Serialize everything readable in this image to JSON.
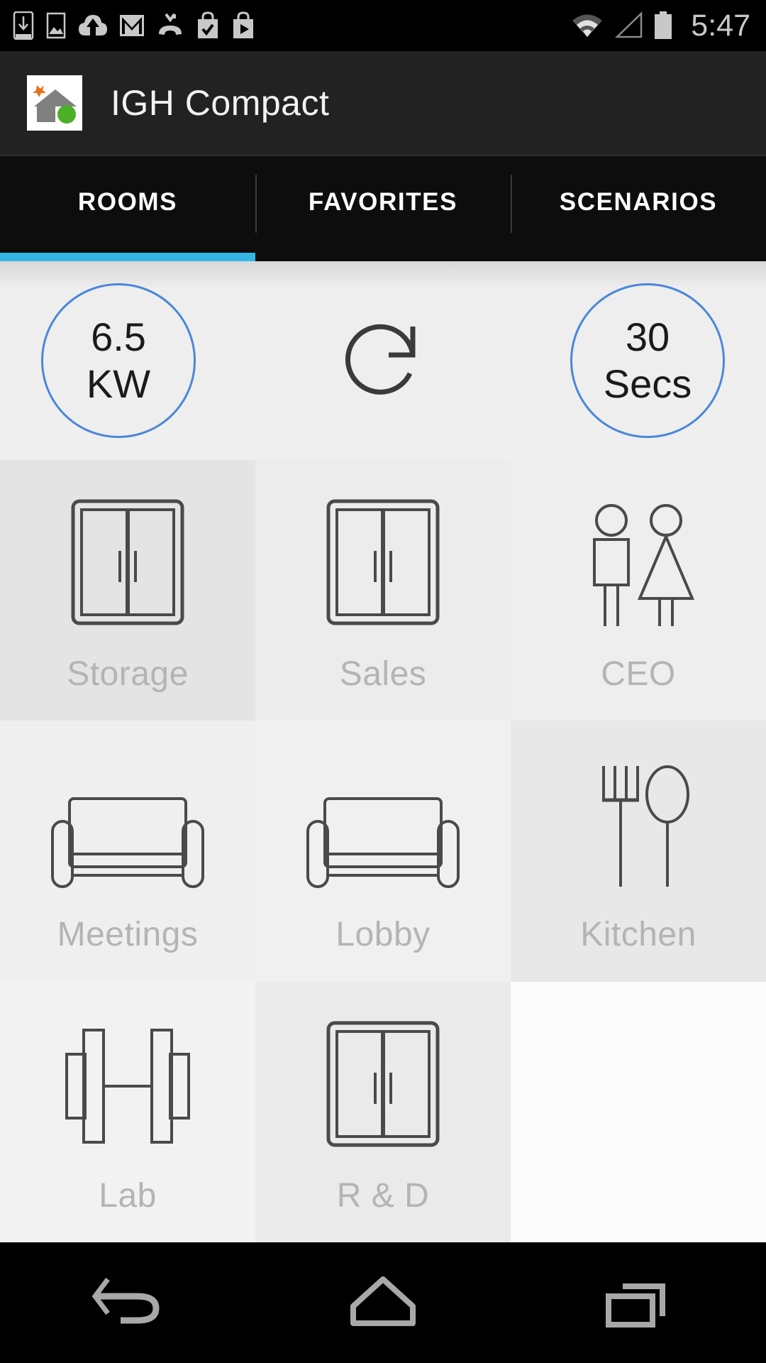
{
  "status_bar": {
    "icons": [
      "download-icon",
      "photo-icon",
      "cloud-upload-icon",
      "gmail-icon",
      "missed-call-icon",
      "shopping-bag-check-icon",
      "play-store-bag-icon"
    ],
    "right_icons": [
      "wifi-icon",
      "cell-signal-icon",
      "battery-icon"
    ],
    "time": "5:47"
  },
  "app_bar": {
    "logo": "igh-house-logo",
    "title": "IGH Compact",
    "logo_colors": {
      "background": "#ffffff",
      "star": "#e8711a",
      "house": "#808080",
      "dot": "#4caf27"
    }
  },
  "tabs": {
    "items": [
      {
        "label": "ROOMS",
        "active": true
      },
      {
        "label": "FAVORITES",
        "active": false
      },
      {
        "label": "SCENARIOS",
        "active": false
      }
    ],
    "indicator_color": "#33b5e5"
  },
  "power_bar": {
    "accent_color": "#4a87d8",
    "power_gauge": {
      "name": "power-gauge",
      "value": "6.5",
      "unit": "KW"
    },
    "refresh": {
      "name": "refresh-button",
      "icon": "refresh-icon"
    },
    "interval_gauge": {
      "name": "refresh-interval-gauge",
      "value": "30",
      "unit": "Secs"
    }
  },
  "rooms": [
    {
      "label": "Storage",
      "icon": "wardrobe-icon",
      "bg": "#e4e4e4"
    },
    {
      "label": "Sales",
      "icon": "wardrobe-icon",
      "bg": "#ececec"
    },
    {
      "label": "CEO",
      "icon": "restroom-icon",
      "bg": "#eeeeee"
    },
    {
      "label": "Meetings",
      "icon": "sofa-icon",
      "bg": "#efefef"
    },
    {
      "label": "Lobby",
      "icon": "sofa-icon",
      "bg": "#f0f0f0"
    },
    {
      "label": "Kitchen",
      "icon": "cutlery-icon",
      "bg": "#e8e8e8"
    },
    {
      "label": "Lab",
      "icon": "dumbbell-icon",
      "bg": "#f2f2f2"
    },
    {
      "label": "R & D",
      "icon": "wardrobe-icon",
      "bg": "#eaeaea"
    },
    {
      "label": "",
      "icon": "",
      "bg": "#fcfcfc"
    }
  ],
  "nav_bar": {
    "buttons": [
      {
        "name": "back-button",
        "icon": "back-arrow-icon"
      },
      {
        "name": "home-button",
        "icon": "home-icon"
      },
      {
        "name": "recents-button",
        "icon": "recents-icon"
      }
    ]
  }
}
